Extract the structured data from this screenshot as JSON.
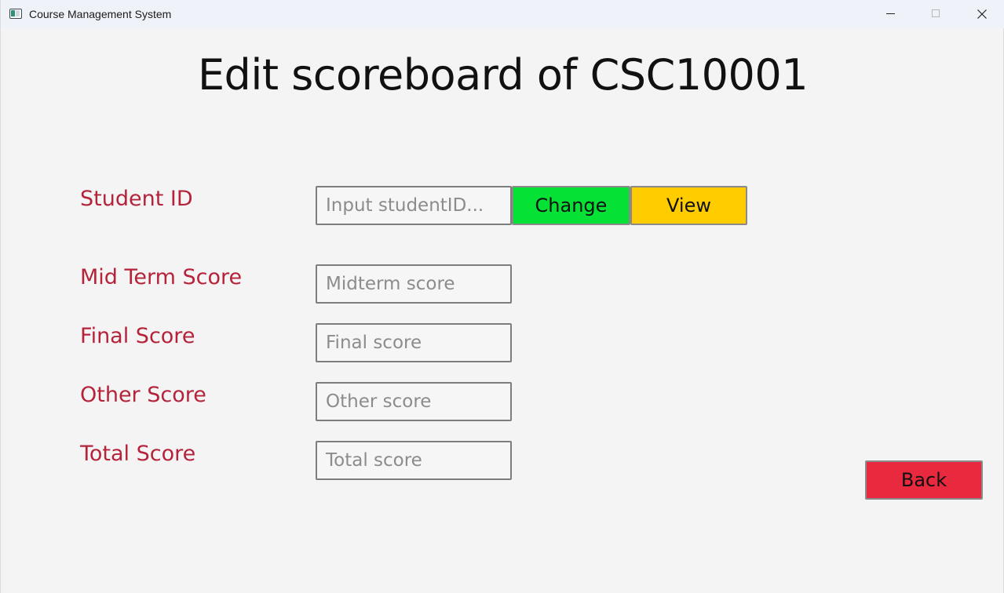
{
  "window": {
    "title": "Course Management System"
  },
  "page": {
    "heading": "Edit scoreboard of CSC10001"
  },
  "form": {
    "student_id": {
      "label": "Student ID",
      "placeholder": "Input studentID...",
      "value": ""
    },
    "midterm": {
      "label": "Mid Term Score",
      "placeholder": "Midterm score",
      "value": ""
    },
    "final": {
      "label": "Final Score",
      "placeholder": "Final score",
      "value": ""
    },
    "other": {
      "label": "Other Score",
      "placeholder": "Other score",
      "value": ""
    },
    "total": {
      "label": "Total Score",
      "placeholder": "Total score",
      "value": ""
    }
  },
  "buttons": {
    "change": "Change",
    "view": "View",
    "back": "Back"
  },
  "colors": {
    "label": "#b5233b",
    "change_button": "#05e235",
    "view_button": "#ffcc00",
    "back_button": "#e8293e"
  },
  "icons": {
    "app": "app-window-icon",
    "minimize": "minimize-icon",
    "maximize": "maximize-icon",
    "close": "close-icon"
  }
}
